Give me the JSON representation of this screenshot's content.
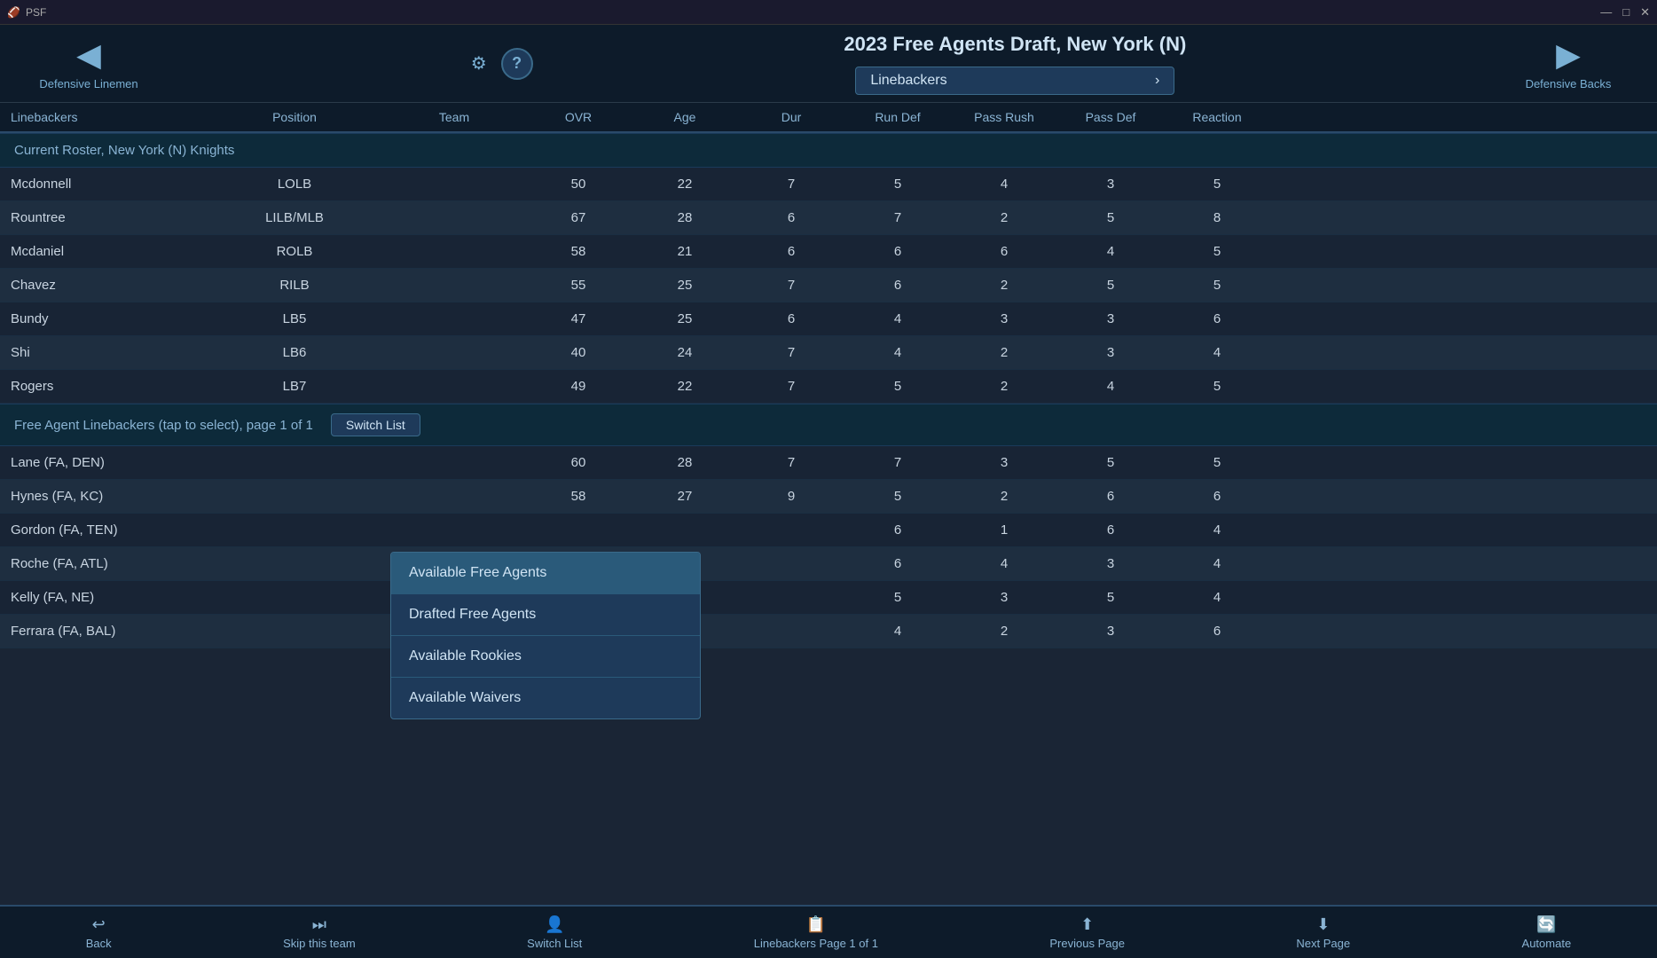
{
  "titleBar": {
    "appName": "PSF",
    "minimizeBtn": "—",
    "maximizeBtn": "□",
    "closeBtn": "✕"
  },
  "navBar": {
    "leftLabel": "Defensive Linemen",
    "leftArrow": "◀",
    "title": "2023 Free Agents Draft, New York (N)",
    "positionSelector": "Linebackers",
    "positionSelectorArrow": "›",
    "rightLabel": "Defensive Backs",
    "rightArrow": "▶",
    "helpLabel": "?"
  },
  "columns": [
    "Linebackers",
    "Position",
    "Team",
    "OVR",
    "Age",
    "Dur",
    "Run Def",
    "Pass Rush",
    "Pass Def",
    "Reaction"
  ],
  "rosterSection": {
    "label": "Current Roster, New York (N) Knights"
  },
  "rosterRows": [
    {
      "name": "Mcdonnell",
      "pos": "LOLB",
      "team": "",
      "ovr": "50",
      "age": "22",
      "dur": "7",
      "rundef": "5",
      "passrush": "4",
      "passdef": "3",
      "reaction": "5"
    },
    {
      "name": "Rountree",
      "pos": "LILB/MLB",
      "team": "",
      "ovr": "67",
      "age": "28",
      "dur": "6",
      "rundef": "7",
      "passrush": "2",
      "passdef": "5",
      "reaction": "8"
    },
    {
      "name": "Mcdaniel",
      "pos": "ROLB",
      "team": "",
      "ovr": "58",
      "age": "21",
      "dur": "6",
      "rundef": "6",
      "passrush": "6",
      "passdef": "4",
      "reaction": "5"
    },
    {
      "name": "Chavez",
      "pos": "RILB",
      "team": "",
      "ovr": "55",
      "age": "25",
      "dur": "7",
      "rundef": "6",
      "passrush": "2",
      "passdef": "5",
      "reaction": "5"
    },
    {
      "name": "Bundy",
      "pos": "LB5",
      "team": "",
      "ovr": "47",
      "age": "25",
      "dur": "6",
      "rundef": "4",
      "passrush": "3",
      "passdef": "3",
      "reaction": "6"
    },
    {
      "name": "Shi",
      "pos": "LB6",
      "team": "",
      "ovr": "40",
      "age": "24",
      "dur": "7",
      "rundef": "4",
      "passrush": "2",
      "passdef": "3",
      "reaction": "4"
    },
    {
      "name": "Rogers",
      "pos": "LB7",
      "team": "",
      "ovr": "49",
      "age": "22",
      "dur": "7",
      "rundef": "5",
      "passrush": "2",
      "passdef": "4",
      "reaction": "5"
    }
  ],
  "freeAgentsSection": {
    "label": "Free Agent Linebackers (tap to select), page 1 of 1",
    "switchListBtn": "Switch List"
  },
  "freeAgentRows": [
    {
      "name": "Lane (FA, DEN)",
      "pos": "",
      "team": "",
      "ovr": "60",
      "age": "28",
      "dur": "7",
      "rundef": "7",
      "passrush": "3",
      "passdef": "5",
      "reaction": "5"
    },
    {
      "name": "Hynes (FA, KC)",
      "pos": "",
      "team": "",
      "ovr": "58",
      "age": "27",
      "dur": "9",
      "rundef": "5",
      "passrush": "2",
      "passdef": "6",
      "reaction": "6"
    },
    {
      "name": "Gordon (FA, TEN)",
      "pos": "",
      "team": "",
      "ovr": "",
      "age": "",
      "dur": "",
      "rundef": "6",
      "passrush": "1",
      "passdef": "6",
      "reaction": "4"
    },
    {
      "name": "Roche (FA, ATL)",
      "pos": "",
      "team": "",
      "ovr": "",
      "age": "",
      "dur": "",
      "rundef": "6",
      "passrush": "4",
      "passdef": "3",
      "reaction": "4"
    },
    {
      "name": "Kelly (FA, NE)",
      "pos": "",
      "team": "",
      "ovr": "",
      "age": "",
      "dur": "",
      "rundef": "5",
      "passrush": "3",
      "passdef": "5",
      "reaction": "4"
    },
    {
      "name": "Ferrara (FA, BAL)",
      "pos": "",
      "team": "",
      "ovr": "",
      "age": "",
      "dur": "",
      "rundef": "4",
      "passrush": "2",
      "passdef": "3",
      "reaction": "6"
    }
  ],
  "dropdown": {
    "items": [
      {
        "label": "Available Free Agents",
        "state": "selected"
      },
      {
        "label": "Drafted Free Agents",
        "state": "normal"
      },
      {
        "label": "Available Rookies",
        "state": "normal"
      },
      {
        "label": "Available Waivers",
        "state": "normal"
      }
    ]
  },
  "bottomBar": {
    "backBtn": "Back",
    "skipTeamBtn": "Skip this team",
    "switchListBtn": "Switch List",
    "linebackersPageBtn": "Linebackers Page 1 of 1",
    "prevPageBtn": "Previous Page",
    "nextPageBtn": "Next Page",
    "automateBtn": "Automate"
  }
}
